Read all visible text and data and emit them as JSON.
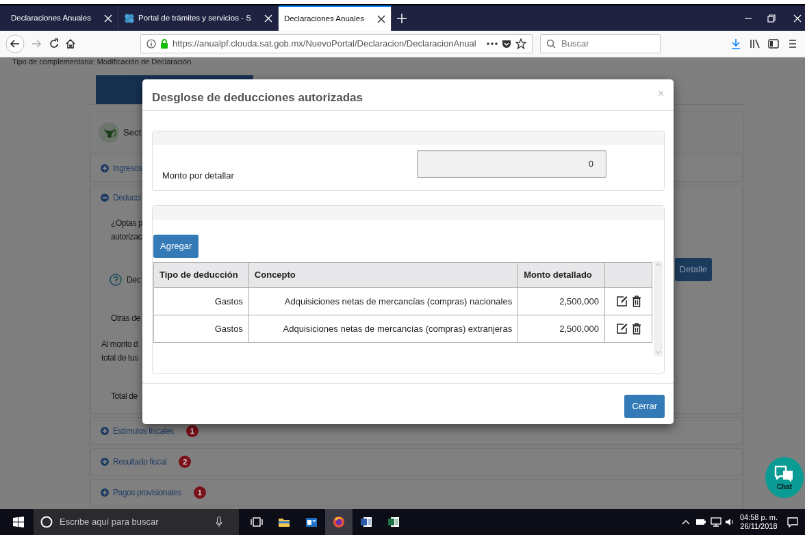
{
  "browser": {
    "tabs": [
      {
        "label": "Declaraciones Anuales",
        "selected": false,
        "has_icon": false
      },
      {
        "label": "Portal de trámites y servicios - S",
        "selected": false,
        "has_icon": true
      },
      {
        "label": "Declaraciones Anuales",
        "selected": true,
        "has_icon": false
      }
    ],
    "url": "https://anualpf.clouda.sat.gob.mx/NuevoPortal/Declaracion/DeclaracionAnual",
    "search": {
      "placeholder": "Buscar"
    }
  },
  "page": {
    "subtitle": "Tipo de complementaria: Modificación de Declaración",
    "section_title": "Sect",
    "accordion": [
      {
        "label": "Ingresos",
        "expanded": false
      },
      {
        "label": "Deducci",
        "expanded": true,
        "content": [
          {
            "kind": "question",
            "lines": [
              "¿Optas p",
              "autorizac"
            ]
          },
          {
            "kind": "help",
            "text": "Dec",
            "button": "Detalle"
          },
          {
            "kind": "field",
            "text": "Otras de"
          },
          {
            "kind": "note",
            "lines": [
              "Al monto d",
              "total de tus"
            ]
          },
          {
            "kind": "field",
            "text": "Total de"
          }
        ]
      },
      {
        "label": "Estímulos fiscales",
        "expanded": false,
        "badge": "1"
      },
      {
        "label": "Resultado fiscal",
        "expanded": false,
        "badge": "2"
      },
      {
        "label": "Pagos provisionales",
        "expanded": false,
        "badge": "1"
      }
    ]
  },
  "modal": {
    "title": "Desglose de deducciones autorizadas",
    "close_icon": "×",
    "amount_label": "Monto por detallar",
    "amount_value": "0",
    "add_button": "Agregar",
    "table": {
      "columns": [
        "Tipo de deducción",
        "Concepto",
        "Monto detallado"
      ],
      "rows": [
        {
          "type": "Gastos",
          "concept": "Adquisiciones netas de mercancías (compras) nacionales",
          "amount": "2,500,000"
        },
        {
          "type": "Gastos",
          "concept": "Adquisiciones netas de mercancías (compras) extranjeras",
          "amount": "2,500,000"
        }
      ]
    },
    "close_button": "Cerrar"
  },
  "chat": {
    "label": "Chat"
  },
  "taskbar": {
    "search_placeholder": "Escribe aquí para buscar",
    "time": "04:58 p. m.",
    "date": "26/11/2018"
  }
}
